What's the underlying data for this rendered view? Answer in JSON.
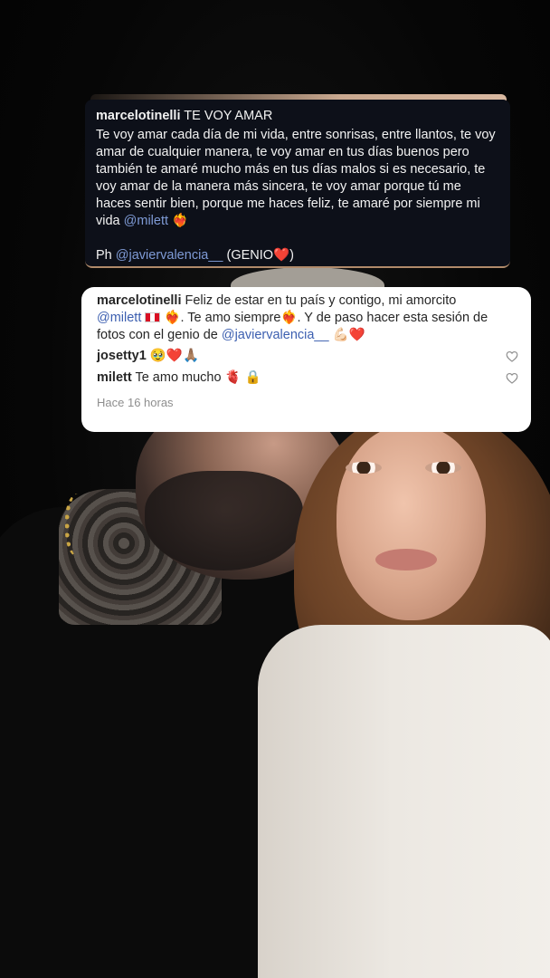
{
  "caption": {
    "username": "marcelotinelli",
    "title": "TE VOY AMAR",
    "body": "Te voy amar cada día de mi vida, entre sonrisas, entre llantos, te voy amar de cualquier manera, te voy amar en tus días buenos pero también te amaré mucho más en tus días malos si es necesario, te voy amar de la manera más sincera, te voy amar porque tú me haces sentir bien, porque me haces feliz, te amaré por siempre mi vida",
    "body_mention": "@milett",
    "body_emoji": "❤️‍🔥",
    "credit_prefix": "Ph",
    "credit_mention": "@javiervalencia__",
    "credit_suffix": "(GENIO",
    "credit_emoji": "❤️",
    "credit_close": ")"
  },
  "comments": [
    {
      "username": "marcelotinelli",
      "text_1": "Feliz de estar en tu país y contigo, mi amorcito",
      "mention_1": "@milett",
      "emoji_heart": "❤️‍🔥",
      "text_2": ". Te amo siempre",
      "text_3": ". Y de paso hacer esta sesión de fotos con el genio de",
      "mention_2": "@javiervalencia__",
      "emoji_arm": "💪🏻",
      "emoji_red": "❤️"
    },
    {
      "username": "josetty1",
      "emoji_face": "🥹",
      "emoji_heart": "❤️",
      "emoji_pray": "🙏🏽"
    },
    {
      "username": "milett",
      "text": "Te amo mucho",
      "emoji_heart": "🫀",
      "emoji_lock": "🔒"
    }
  ],
  "timestamp": "Hace 16 horas",
  "icons": {
    "like": "heart-outline-icon"
  },
  "colors": {
    "mention_dark": "#7f9bd6",
    "mention_light": "#3c5fb0",
    "caption_bg": "#0d1019",
    "card_bg": "#ffffff"
  }
}
